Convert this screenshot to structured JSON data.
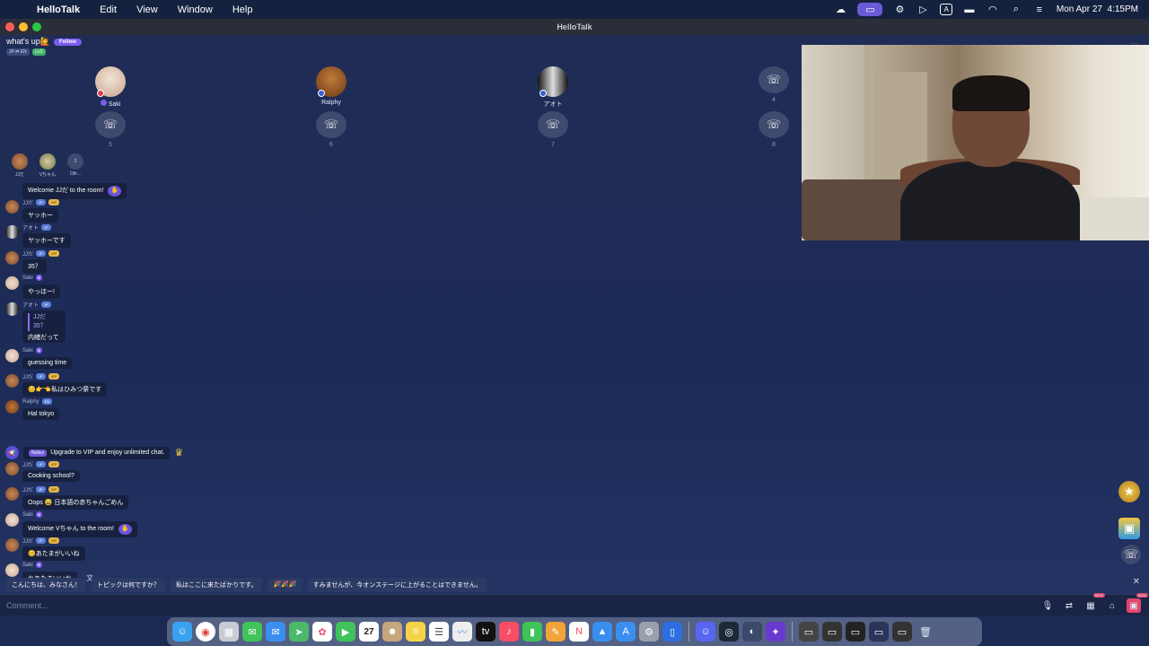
{
  "menubar": {
    "app_name": "HelloTalk",
    "menus": [
      "Edit",
      "View",
      "Window",
      "Help"
    ],
    "date_time": "Mon Apr 27  4:15PM"
  },
  "window": {
    "title": "HelloTalk"
  },
  "room": {
    "title": "what's up🙋",
    "follow_label": "Follow",
    "lang_tag": "JP ⇄ EN",
    "level_tag": "Lv.5"
  },
  "seats": [
    {
      "name": "Saki",
      "num": ""
    },
    {
      "name": "Ralphy",
      "num": ""
    },
    {
      "name": "アオト",
      "num": ""
    },
    {
      "name": "",
      "num": "4"
    },
    {
      "name": "",
      "num": "5"
    },
    {
      "name": "",
      "num": "6"
    },
    {
      "name": "",
      "num": "7"
    },
    {
      "name": "",
      "num": "8"
    }
  ],
  "audience": [
    {
      "name": "JJだ"
    },
    {
      "name": "Vちゃん"
    },
    {
      "name": "Oth...",
      "count": "2"
    }
  ],
  "chat": [
    {
      "type": "system",
      "text": "Welcome JJだ to the room!"
    },
    {
      "user": "JJだ",
      "text": "ヤッホー"
    },
    {
      "user": "アオト",
      "text": "ヤッホーです"
    },
    {
      "user": "JJだ",
      "text": "35？"
    },
    {
      "user": "Saki",
      "text": "やっほー!"
    },
    {
      "user": "アオト",
      "quote_user": "JJだ",
      "quote_text": "35？",
      "text": "内緒だって"
    },
    {
      "user": "Saki",
      "text": "guessing time"
    },
    {
      "user": "JJだ",
      "text": "😊👉👈私はひみつ祭です"
    },
    {
      "user": "Ralphy",
      "text": "Hal tokyo"
    },
    {
      "user": "JJだ",
      "text": "Cooking school?"
    },
    {
      "user": "JJだ",
      "text": "Oops 😅 日本語の赤ちゃんごめん"
    },
    {
      "type": "system",
      "text": "Welcome Vちゃん to the room!"
    },
    {
      "user": "JJだ",
      "text": "😊あたまがいいね"
    },
    {
      "user": "Saki",
      "text": "ねあたまいいね"
    }
  ],
  "notice": {
    "tag": "Notice",
    "text": "Upgrade to VIP and enjoy unlimited chat."
  },
  "quick_replies": [
    "こんにちは、みなさん！",
    "トピックは何ですか？",
    "私はここに来たばかりです。",
    "🎉🎉🎉",
    "すみませんが、今オンステージに上がることはできません。"
  ],
  "input": {
    "placeholder": "Comment...",
    "new_badge": "NEW"
  },
  "dock_calendar_day": "27",
  "colors": {
    "background": "#1d2b58",
    "accent": "#7c5cf0",
    "bubble": "#17213f",
    "vip": "#e6b64a"
  }
}
